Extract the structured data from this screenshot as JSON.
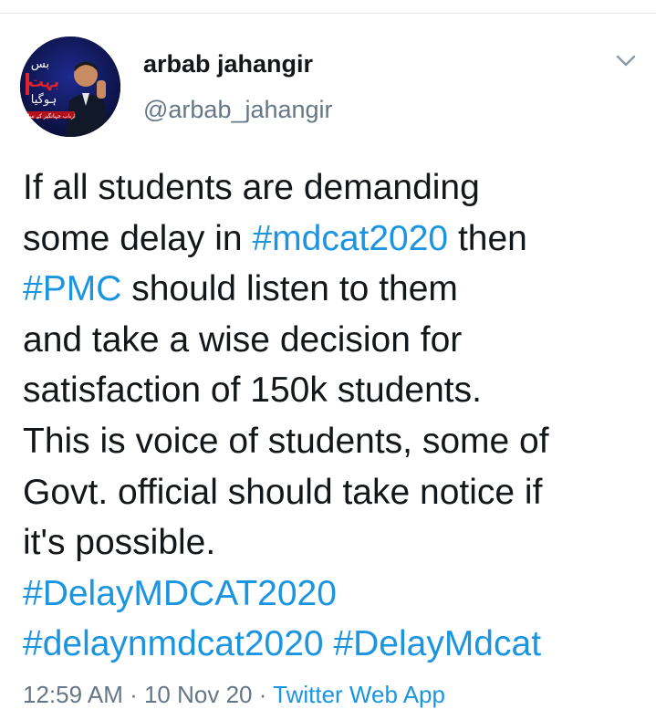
{
  "author": {
    "display_name": "arbab jahangir",
    "handle": "@arbab_jahangir",
    "avatar_caption": "ارباب جہانگیر کے ساتھ",
    "avatar_title_1": "بس",
    "avatar_title_2": "بہت",
    "avatar_title_3": "ہوگیا"
  },
  "menu": {
    "icon": "chevron-down-icon"
  },
  "tweet": {
    "line1": "If all students are demanding",
    "line2_pre": "some delay in ",
    "line2_tag": "#mdcat2020",
    "line2_post": " then",
    "line3_tag": "#PMC",
    "line3_post": " should listen to them",
    "line4": "and take a wise decision for",
    "line5": "satisfaction of 150k students.",
    "line6": "This is voice of students, some of",
    "line7": "Govt. official should take notice if",
    "line8": "it's possible.",
    "line9_tag": "#DelayMDCAT2020",
    "line10_tag1": "#delaynmdcat2020",
    "line10_space": " ",
    "line10_tag2": "#DelayMdcat"
  },
  "meta": {
    "time": "12:59 AM",
    "sep1": " · ",
    "date": "10 Nov 20",
    "sep2": " · ",
    "source": "Twitter Web App"
  },
  "colors": {
    "link": "#1b95e0",
    "text": "#14171a",
    "secondary": "#657786"
  }
}
